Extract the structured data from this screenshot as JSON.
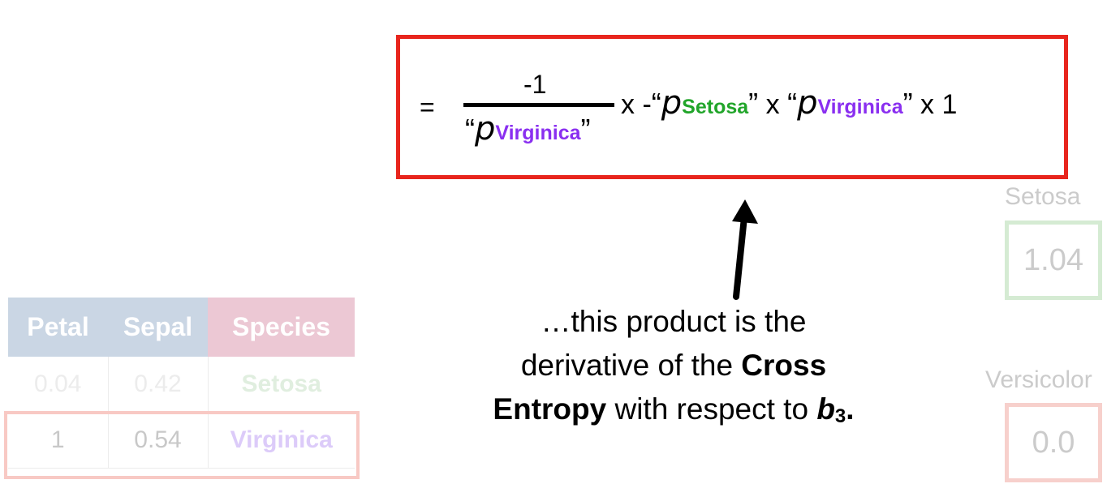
{
  "equation": {
    "equals": "=",
    "numerator": "-1",
    "quote_open": "“",
    "quote_close": "”",
    "p": "p",
    "virginica_sub": "Virginica",
    "setosa_sub": "Setosa",
    "times_neg": "x -",
    "times": "x",
    "times_one": "x 1",
    "colors": {
      "setosa": "#21a52a",
      "virginica": "#8a2ff0",
      "box_border": "#e8251d"
    }
  },
  "caption": {
    "line1": "…this product is the",
    "line2_start": "derivative of the ",
    "cross": "Cross",
    "entropy": "Entropy",
    "line3_mid": " with respect to ",
    "b": "b",
    "b_sub": "3",
    "period": "."
  },
  "table": {
    "headers": [
      "Petal",
      "Sepal",
      "Species"
    ],
    "rows": [
      [
        "0.04",
        "0.42",
        "Setosa"
      ],
      [
        "1",
        "0.54",
        "Virginica"
      ]
    ]
  },
  "nodes": {
    "setosa": {
      "label": "Setosa",
      "value": "1.04"
    },
    "versicolor": {
      "label": "Versicolor",
      "value": "0.0"
    }
  }
}
